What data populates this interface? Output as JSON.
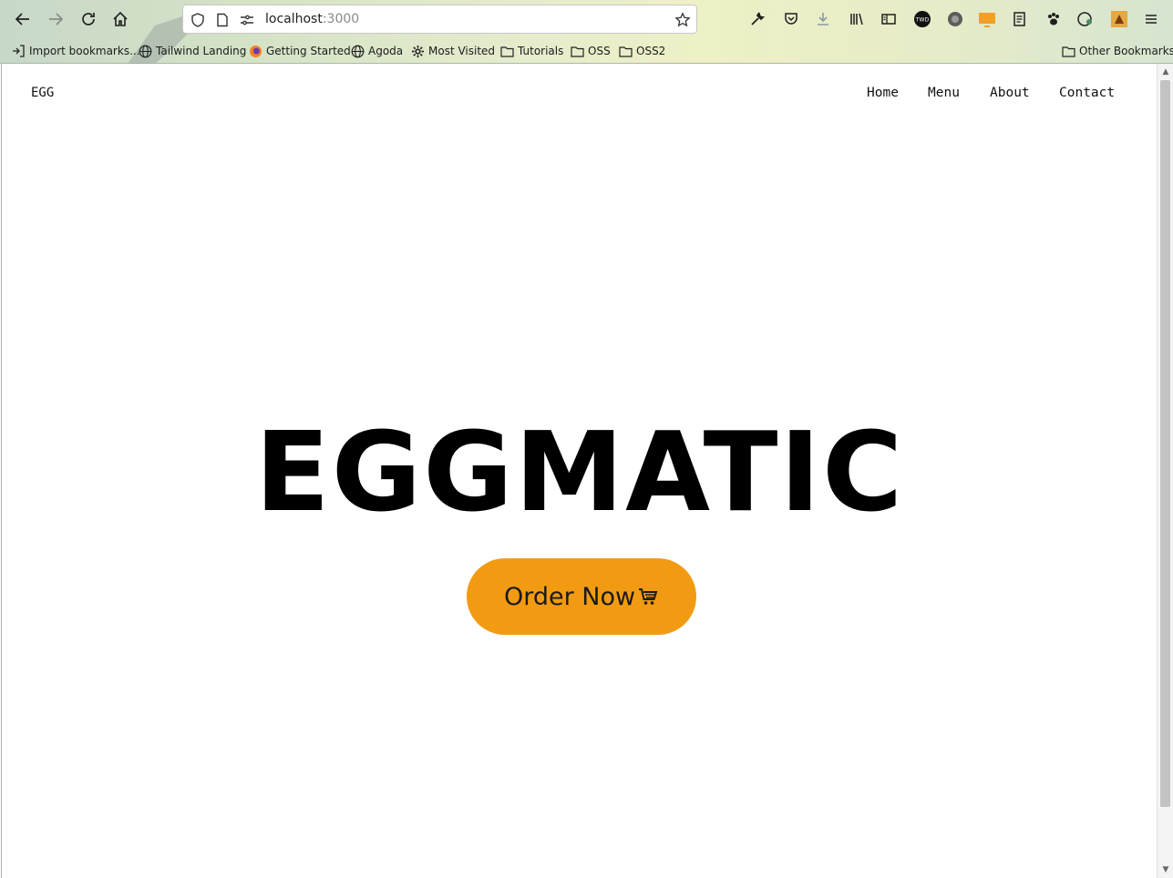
{
  "browser": {
    "url_host": "localhost",
    "url_port": ":3000",
    "bookmarks": [
      {
        "label": "Import bookmarks...",
        "icon": "import-icon"
      },
      {
        "label": "Tailwind Landing",
        "icon": "globe-icon"
      },
      {
        "label": "Getting Started",
        "icon": "firefox-icon"
      },
      {
        "label": "Agoda",
        "icon": "globe-icon"
      },
      {
        "label": "Most Visited",
        "icon": "gear-icon"
      },
      {
        "label": "Tutorials",
        "icon": "folder-icon"
      },
      {
        "label": "OSS",
        "icon": "folder-icon"
      },
      {
        "label": "OSS2",
        "icon": "folder-icon"
      }
    ],
    "other_bookmarks": "Other Bookmarks",
    "extension_badge": "TWD"
  },
  "site": {
    "brand": "EGG",
    "nav": [
      {
        "label": "Home"
      },
      {
        "label": "Menu"
      },
      {
        "label": "About"
      },
      {
        "label": "Contact"
      }
    ],
    "hero_title": "EGGMATIC",
    "cta_label": "Order Now",
    "cta_icon": "cart-icon"
  },
  "colors": {
    "cta_background": "#f29b12",
    "hero_text": "#000000",
    "page_background": "#ffffff"
  }
}
